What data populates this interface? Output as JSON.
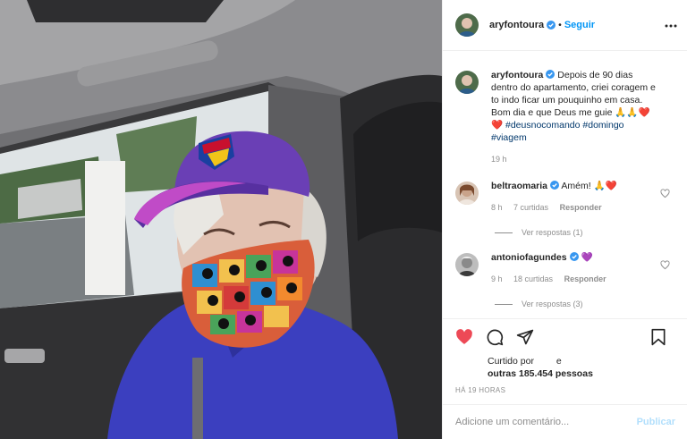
{
  "post": {
    "author": "aryfontoura",
    "follow_label": "Seguir",
    "separator": "•"
  },
  "caption": {
    "username": "aryfontoura",
    "text": "Depois de 90 dias dentro do apartamento, criei coragem e to indo ficar um pouquinho em casa. Bom dia e que Deus me guie 🙏🙏❤️❤️ ",
    "hashtags": [
      "#deusnocomando",
      "#domingo",
      "#viagem"
    ],
    "time": "19 h"
  },
  "comments": [
    {
      "username": "beltraomaria",
      "text": "Amém! 🙏❤️",
      "time": "8 h",
      "likes": "7 curtidas",
      "reply_label": "Responder",
      "view_replies": "Ver respostas (1)"
    },
    {
      "username": "antoniofagundes",
      "text": "💜",
      "time": "9 h",
      "likes": "18 curtidas",
      "reply_label": "Responder",
      "view_replies": "Ver respostas (3)"
    }
  ],
  "likes": {
    "prefix": "Curtido por",
    "liker": "",
    "conj": "e",
    "others": "outras 185.454 pessoas"
  },
  "timestamp": "HÁ 19 HORAS",
  "comment_box": {
    "placeholder": "Adicione um comentário...",
    "publish_label": "Publicar"
  },
  "colors": {
    "link_blue": "#0095f6",
    "like_red": "#ed4956",
    "tag_blue": "#00376b",
    "muted_gray": "#8e8e8e"
  },
  "icons": [
    "verified-badge-icon",
    "more-options-icon",
    "heart-icon",
    "comment-icon",
    "share-icon",
    "bookmark-icon"
  ]
}
